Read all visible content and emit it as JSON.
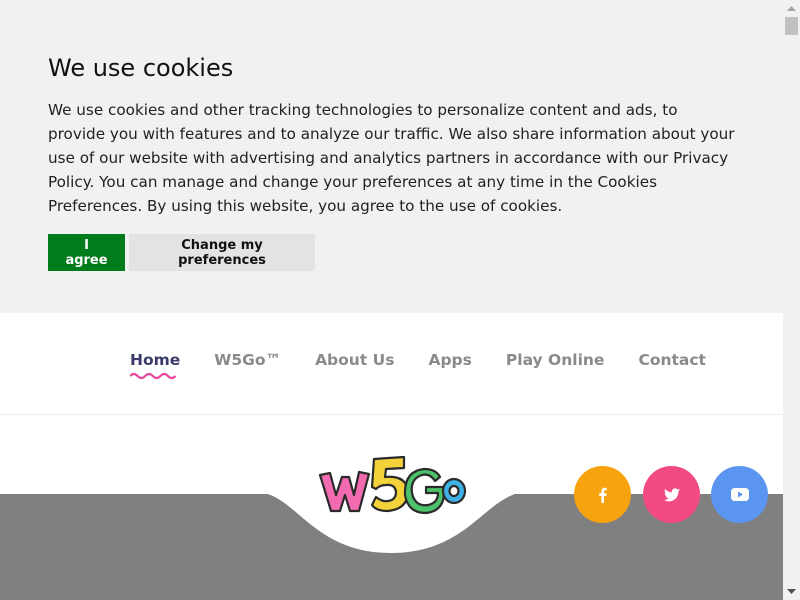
{
  "cookie_banner": {
    "title": "We use cookies",
    "text": "We use cookies and other tracking technologies to personalize content and ads, to provide you with features and to analyze our traffic. We also share information about your use of our website with advertising and analytics partners in accordance with our Privacy Policy. You can manage and change your preferences at any time in the Cookies Preferences. By using this website, you agree to the use of cookies.",
    "agree_label": "I agree",
    "preferences_label": "Change my preferences"
  },
  "nav": {
    "items": [
      {
        "label": "Home",
        "active": true
      },
      {
        "label": "W5Go™",
        "active": false
      },
      {
        "label": "About Us",
        "active": false
      },
      {
        "label": "Apps",
        "active": false
      },
      {
        "label": "Play Online",
        "active": false
      },
      {
        "label": "Contact",
        "active": false
      }
    ]
  },
  "logo": {
    "text": "W5GO"
  },
  "social": {
    "facebook": {
      "icon": "facebook-icon",
      "color": "#f7a20f"
    },
    "twitter": {
      "icon": "twitter-icon",
      "color": "#f24b84"
    },
    "youtube": {
      "icon": "youtube-icon",
      "color": "#5a96f1"
    }
  },
  "colors": {
    "agree_button": "#017b1c",
    "active_nav_underline": "#e8479a",
    "hero_background": "#808080"
  }
}
